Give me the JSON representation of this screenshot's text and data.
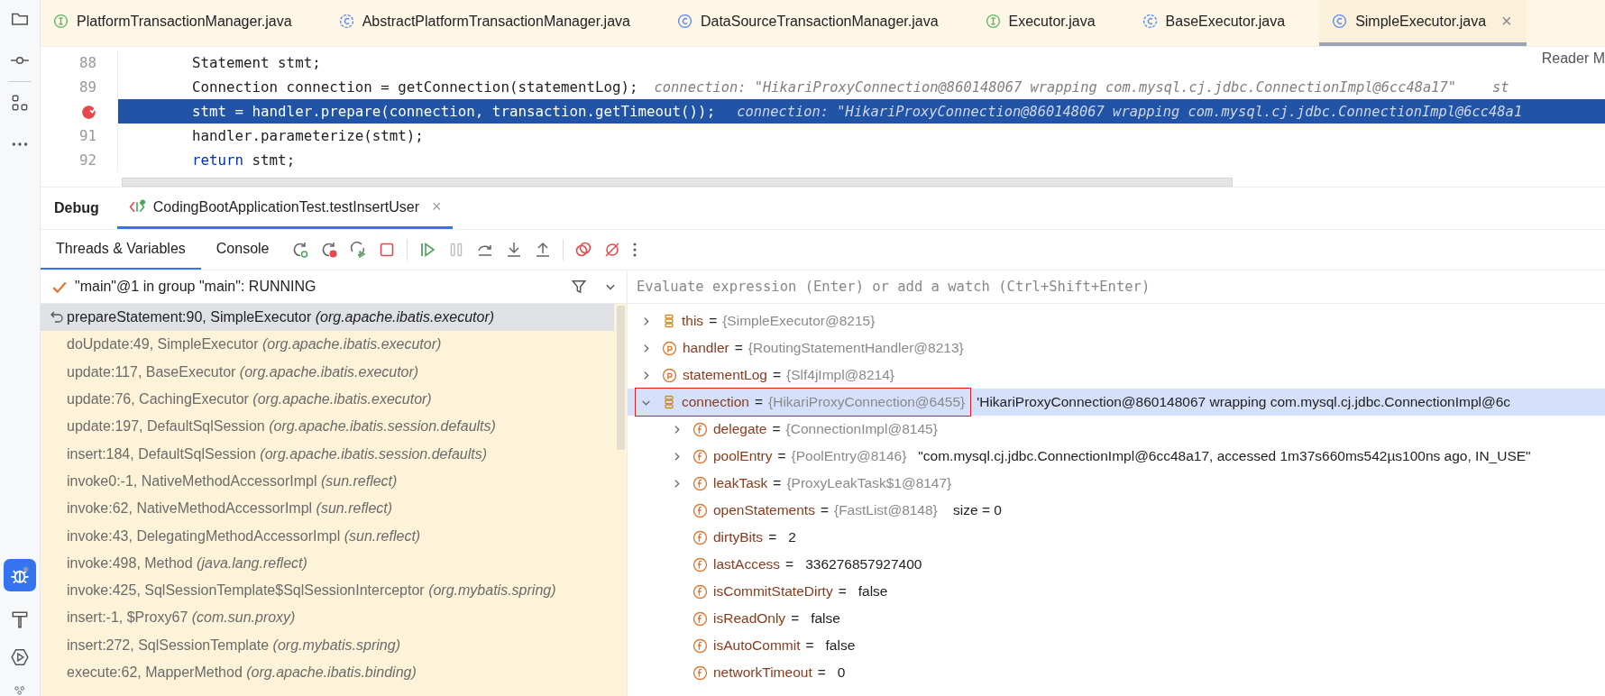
{
  "editor_tabs": [
    {
      "label": "PlatformTransactionManager.java",
      "kind": "interface",
      "selected": false
    },
    {
      "label": "AbstractPlatformTransactionManager.java",
      "kind": "abstract",
      "selected": false
    },
    {
      "label": "DataSourceTransactionManager.java",
      "kind": "class",
      "selected": false
    },
    {
      "label": "Executor.java",
      "kind": "interface",
      "selected": false
    },
    {
      "label": "BaseExecutor.java",
      "kind": "abstract",
      "selected": false
    },
    {
      "label": "SimpleExecutor.java",
      "kind": "class",
      "selected": true
    }
  ],
  "close_tab": "×",
  "reader_mode": "Reader M",
  "code_lines": [
    {
      "number": "88",
      "breakpoint": false,
      "selected": false,
      "code": [
        {
          "kind": "plain",
          "text": "Statement stmt;"
        }
      ]
    },
    {
      "number": "89",
      "breakpoint": false,
      "selected": false,
      "code": [
        {
          "kind": "plain",
          "text": "Connection connection = getConnection(statementLog);"
        }
      ],
      "hints": [
        "connection: \"HikariProxyConnection@860148067 wrapping com.mysql.cj.jdbc.ConnectionImpl@6cc48a17\"",
        "st"
      ]
    },
    {
      "breakpoint": true,
      "selected": true,
      "code": [
        {
          "kind": "plain",
          "text": "stmt = handler.prepare(connection, transaction.getTimeout());"
        }
      ],
      "hints": [
        "connection: \"HikariProxyConnection@860148067 wrapping com.mysql.cj.jdbc.ConnectionImpl@6cc48a1"
      ]
    },
    {
      "number": "91",
      "breakpoint": false,
      "selected": false,
      "code": [
        {
          "kind": "plain",
          "text": "handler.parameterize(stmt);"
        }
      ]
    },
    {
      "number": "92",
      "breakpoint": false,
      "selected": false,
      "code": [
        {
          "kind": "keyword",
          "text": "return"
        },
        {
          "kind": "plain",
          "text": " stmt;"
        }
      ]
    }
  ],
  "debug": {
    "title": "Debug",
    "session_tab": "CodingBootApplicationTest.testInsertUser",
    "session_close": "×"
  },
  "view_tabs": [
    {
      "label": "Threads & Variables",
      "selected": true
    },
    {
      "label": "Console",
      "selected": false
    }
  ],
  "thread": "\"main\"@1 in group \"main\": RUNNING",
  "evaluate": {
    "placeholder": "Evaluate expression (Enter) or add a watch (Ctrl+Shift+Enter)"
  },
  "frames": [
    {
      "text": "prepareStatement:90, SimpleExecutor *(org.apache.ibatis.executor)*",
      "selected": true
    },
    {
      "text": "doUpdate:49, SimpleExecutor *(org.apache.ibatis.executor)*",
      "selected": false
    },
    {
      "text": "update:117, BaseExecutor *(org.apache.ibatis.executor)*",
      "selected": false
    },
    {
      "text": "update:76, CachingExecutor *(org.apache.ibatis.executor)*",
      "selected": false
    },
    {
      "text": "update:197, DefaultSqlSession *(org.apache.ibatis.session.defaults)*",
      "selected": false
    },
    {
      "text": "insert:184, DefaultSqlSession *(org.apache.ibatis.session.defaults)*",
      "selected": false
    },
    {
      "text": "invoke0:-1, NativeMethodAccessorImpl *(sun.reflect)*",
      "selected": false
    },
    {
      "text": "invoke:62, NativeMethodAccessorImpl *(sun.reflect)*",
      "selected": false
    },
    {
      "text": "invoke:43, DelegatingMethodAccessorImpl *(sun.reflect)*",
      "selected": false
    },
    {
      "text": "invoke:498, Method *(java.lang.reflect)*",
      "selected": false
    },
    {
      "text": "invoke:425, SqlSessionTemplate$SqlSessionInterceptor *(org.mybatis.spring)*",
      "selected": false
    },
    {
      "text": "insert:-1, $Proxy67 *(com.sun.proxy)*",
      "selected": false
    },
    {
      "text": "insert:272, SqlSessionTemplate *(org.mybatis.spring)*",
      "selected": false
    },
    {
      "text": "execute:62, MapperMethod *(org.apache.ibatis.binding)*",
      "selected": false
    }
  ],
  "variables": [
    {
      "kind": "local",
      "name": "this",
      "op": "=",
      "type": "{SimpleExecutor@8215}",
      "expanded": false,
      "selected": false,
      "highlighted": false
    },
    {
      "kind": "param",
      "name": "handler",
      "op": "=",
      "type": "{RoutingStatementHandler@8213}",
      "expanded": false,
      "selected": false,
      "highlighted": false
    },
    {
      "kind": "param",
      "name": "statementLog",
      "op": "=",
      "type": "{Slf4jImpl@8214}",
      "expanded": false,
      "selected": false,
      "highlighted": false
    },
    {
      "kind": "local",
      "name": "connection",
      "op": "=",
      "type": "{HikariProxyConnection@6455}",
      "value": "'HikariProxyConnection@860148067 wrapping com.mysql.cj.jdbc.ConnectionImpl@6c",
      "expanded": true,
      "selected": true,
      "highlighted": true,
      "children": [
        {
          "kind": "field",
          "name": "delegate",
          "op": "=",
          "type": "{ConnectionImpl@8145}",
          "expanded": false,
          "selected": false,
          "highlighted": false
        },
        {
          "kind": "field",
          "name": "poolEntry",
          "op": "=",
          "type": "{PoolEntry@8146}",
          "value": "\"com.mysql.cj.jdbc.ConnectionImpl@6cc48a17, accessed 1m37s660ms542µs100ns ago, IN_USE\"",
          "expanded": false,
          "selected": false,
          "highlighted": false
        },
        {
          "kind": "field",
          "name": "leakTask",
          "op": "=",
          "type": "{ProxyLeakTask$1@8147}",
          "expanded": false,
          "selected": false,
          "highlighted": false
        },
        {
          "kind": "field",
          "name": "openStatements",
          "op": "=",
          "type": "{FastList@8148}",
          "value": " size = 0",
          "selected": false,
          "highlighted": false
        },
        {
          "kind": "field",
          "name": "dirtyBits",
          "op": "=",
          "value": "2",
          "selected": false,
          "highlighted": false
        },
        {
          "kind": "field",
          "name": "lastAccess",
          "op": "=",
          "value": "336276857927400",
          "selected": false,
          "highlighted": false
        },
        {
          "kind": "field",
          "name": "isCommitStateDirty",
          "op": "=",
          "value": "false",
          "selected": false,
          "highlighted": false
        },
        {
          "kind": "field",
          "name": "isReadOnly",
          "op": "=",
          "value": "false",
          "selected": false,
          "highlighted": false
        },
        {
          "kind": "field",
          "name": "isAutoCommit",
          "op": "=",
          "value": "false",
          "selected": false,
          "highlighted": false
        },
        {
          "kind": "field",
          "name": "networkTimeout",
          "op": "=",
          "value": "0",
          "selected": false,
          "highlighted": false
        }
      ]
    }
  ]
}
